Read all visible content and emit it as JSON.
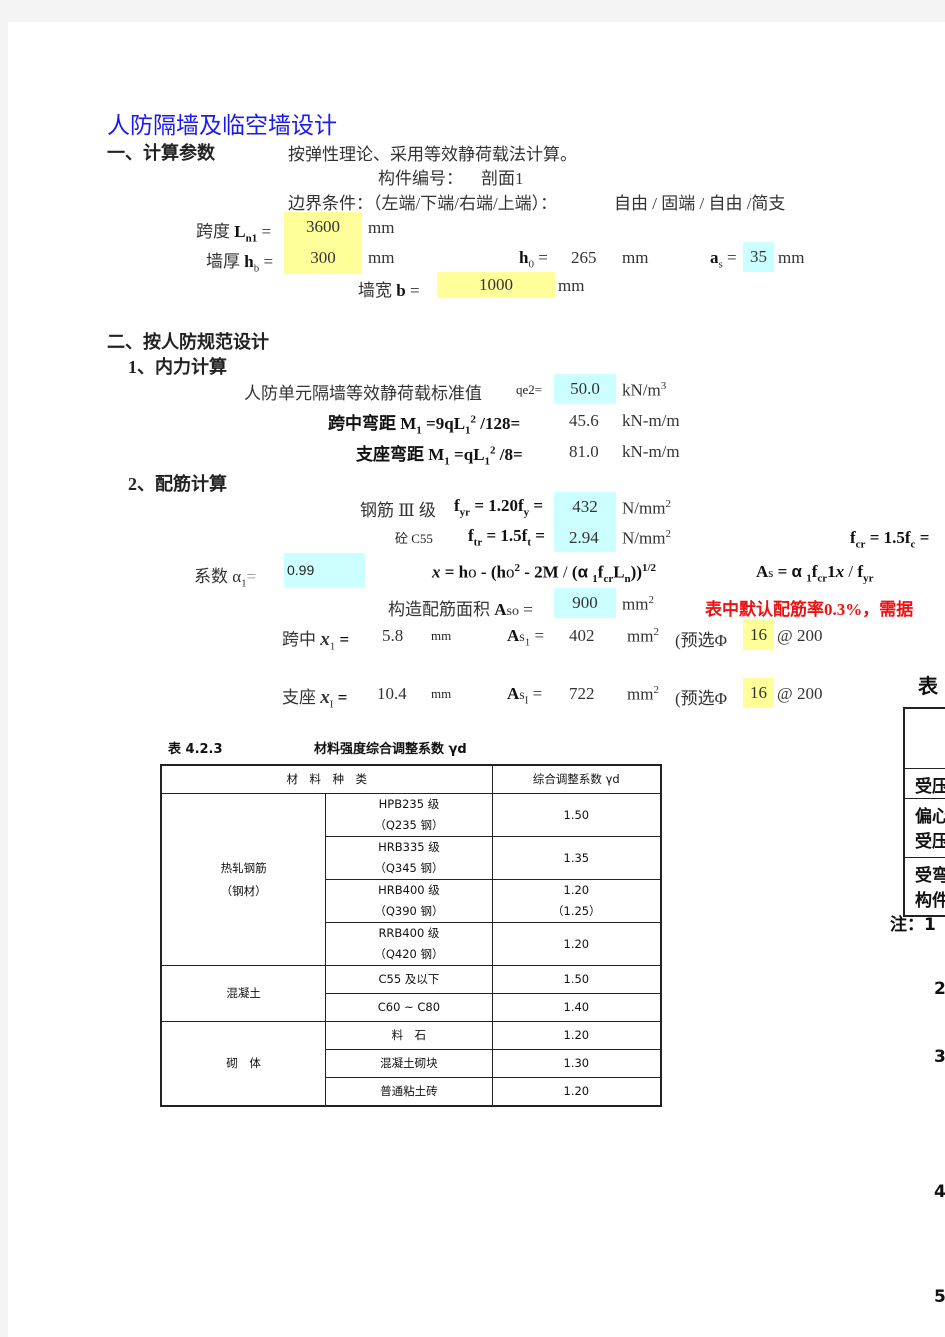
{
  "title": "人防隔墙及临空墙设计",
  "section1": {
    "heading": "一、计算参数",
    "method": "按弹性理论、采用等效静荷载法计算。",
    "member_label": "构件编号：",
    "member_value": "剖面1",
    "boundary_label": "边界条件：（左端/下端/右端/上端）：",
    "boundary_value": "自由 / 固端 / 自由 /简支",
    "span_label": "跨度",
    "span_symbol": "L",
    "span_sub": "n1",
    "span_value": "3600",
    "thick_label": "墙厚",
    "thick_symbol": "h",
    "thick_sub": "b",
    "thick_value": "300",
    "h0_symbol": "h",
    "h0_sub": "0",
    "h0_value": "265",
    "as_symbol": "a",
    "as_sub": "s",
    "as_value": "35",
    "width_label": "墙宽",
    "width_symbol": "b",
    "width_value": "1000",
    "unit_mm": "mm",
    "eq": "="
  },
  "section2": {
    "heading": "二、按人防规范设计",
    "sub1": "1、内力计算",
    "load_label": "人防单元隔墙等效静荷载标准值",
    "load_symbol": "qe2=",
    "load_value": "50.0",
    "load_unit": "kN/m",
    "load_unit_sup": "3",
    "m_mid_label": "跨中弯距",
    "m_mid_formula_a": "M",
    "m_mid_formula_sub": "1",
    "m_mid_formula_b": " =9qL",
    "m_mid_formula_c": "1",
    "m_mid_formula_sup": "2",
    "m_mid_formula_d": " /128=",
    "m_mid_value": "45.6",
    "m_sup_label": "支座弯距",
    "m_sup_formula_b": " =qL",
    "m_sup_formula_d": " /8=",
    "m_sup_value": "81.0",
    "moment_unit": "kN-m/m",
    "sub2": "2、配筋计算",
    "steel_label": "钢筋 Ⅲ 级",
    "steel_formula": "f",
    "steel_sub": "yr",
    "steel_formula2": " = 1.20f",
    "steel_sub2": "y",
    "steel_value": "432",
    "stress_unit": "N/mm",
    "stress_sup": "2",
    "conc_label": "砼 C55",
    "conc_sub": "tr",
    "conc_formula2": " = 1.5f",
    "conc_sub2": "t",
    "conc_value": "2.94",
    "fcr_sub": "cr",
    "fcr_formula2": " = 1.5f",
    "fcr_sub2": "c",
    "alpha_label": "系数 α",
    "alpha_sub": "1",
    "alpha_eq": "=",
    "alpha_value": "0.99",
    "x_formula": "𝑥 = ho - (ho² - 2M / (α ₁f꜀ᵣLₙ))^1/2",
    "x_formula_parts": [
      "x",
      " = ",
      "h",
      "o",
      " - (",
      "h",
      "o",
      "2",
      " - ",
      "2M",
      " / (",
      "α",
      "1",
      "f",
      "cr",
      "L",
      "n",
      "))",
      "1/2"
    ],
    "as_formula_parts": [
      "A",
      "s",
      " = ",
      "α",
      "1",
      "f",
      "cr",
      "1",
      "x",
      " / ",
      "f",
      "yr"
    ],
    "aso_label": "构造配筋面积",
    "aso_symbol": "A",
    "aso_sub": "so",
    "aso_value": "900",
    "area_unit": "mm",
    "area_sup": "2",
    "note": "表中默认配筋率0.3%，需据",
    "mid_label": "跨中",
    "mid_sub": "1",
    "mid_x": "5.8",
    "mid_as_sub": "1",
    "mid_as": "402",
    "pre_select": "(预选Φ",
    "mid_dia": "16",
    "at": "@",
    "mid_spacing": "200",
    "sup_label": "支座",
    "sup_sub": "I",
    "sup_x": "10.4",
    "sup_as_sub": "I",
    "sup_as": "722",
    "sup_dia": "16",
    "sup_spacing": "200"
  },
  "table": {
    "number": "表 4.2.3",
    "caption": "材料强度综合调整系数 γd",
    "header": [
      "材　料　种　类",
      "综合调整系数 γd"
    ],
    "groups": [
      {
        "name": [
          "热轧钢筋",
          "（钢材）"
        ],
        "rows": [
          {
            "type": [
              "HPB235 级",
              "（Q235 钢）"
            ],
            "value": [
              "1.50"
            ]
          },
          {
            "type": [
              "HRB335 级",
              "（Q345 钢）"
            ],
            "value": [
              "1.35"
            ]
          },
          {
            "type": [
              "HRB400 级",
              "（Q390 钢）"
            ],
            "value": [
              "1.20",
              "（1.25）"
            ]
          },
          {
            "type": [
              "RRB400 级",
              "（Q420 钢）"
            ],
            "value": [
              "1.20"
            ]
          }
        ]
      },
      {
        "name": [
          "混凝土"
        ],
        "rows": [
          {
            "type": [
              "C55 及以下"
            ],
            "value": [
              "1.50"
            ]
          },
          {
            "type": [
              "C60 ~ C80"
            ],
            "value": [
              "1.40"
            ]
          }
        ]
      },
      {
        "name": [
          "砌　体"
        ],
        "rows": [
          {
            "type": [
              "料　石"
            ],
            "value": [
              "1.20"
            ]
          },
          {
            "type": [
              "混凝土砌块"
            ],
            "value": [
              "1.30"
            ]
          },
          {
            "type": [
              "普通粘土砖"
            ],
            "value": [
              "1.20"
            ]
          }
        ]
      }
    ]
  },
  "right_fragment": {
    "title": "表",
    "rows": [
      "受压",
      "偏心",
      "受压",
      "受弯",
      "构件"
    ],
    "note": "注：1",
    "numbers": [
      "2",
      "3",
      "4",
      "5"
    ]
  },
  "colors": {
    "title": "#1a1aee",
    "input_yellow": "#ffff99",
    "calc_cyan": "#ccffff",
    "warning_red": "#ee1111",
    "frame_gray": "#f4f4f4"
  }
}
